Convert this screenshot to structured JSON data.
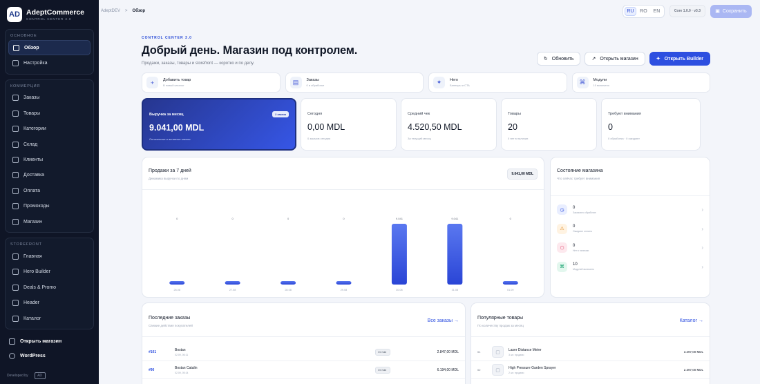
{
  "brand": {
    "name": "AdeptCommerce",
    "subtitle": "CONTROL CENTER 3.0",
    "logo_text": "AD"
  },
  "sidebar": {
    "sections": [
      {
        "title": "ОСНОВНОЕ",
        "items": [
          {
            "label": "Обзор",
            "icon": "grid-icon",
            "active": true
          },
          {
            "label": "Настройка",
            "icon": "sparkle-icon"
          }
        ]
      },
      {
        "title": "КОММЕРЦИЯ",
        "items": [
          {
            "label": "Заказы",
            "icon": "document-icon"
          },
          {
            "label": "Товары",
            "icon": "box-icon"
          },
          {
            "label": "Категории",
            "icon": "grid-icon"
          },
          {
            "label": "Склад",
            "icon": "warehouse-icon"
          },
          {
            "label": "Клиенты",
            "icon": "users-icon"
          },
          {
            "label": "Доставка",
            "icon": "truck-icon"
          },
          {
            "label": "Оплата",
            "icon": "card-icon"
          },
          {
            "label": "Промокоды",
            "icon": "tag-icon"
          },
          {
            "label": "Магазин",
            "icon": "store-icon"
          }
        ]
      },
      {
        "title": "STOREFRONT",
        "items": [
          {
            "label": "Главная",
            "icon": "home-icon"
          },
          {
            "label": "Hero Builder",
            "icon": "sparkle-icon"
          },
          {
            "label": "Deals & Promo",
            "icon": "sparkle-icon"
          },
          {
            "label": "Header",
            "icon": "layout-icon"
          },
          {
            "label": "Каталог",
            "icon": "grid-icon"
          }
        ]
      }
    ],
    "bottom": {
      "open_store": "Открыть магазин",
      "wordpress": "WordPress"
    },
    "developed_by": "Developed by",
    "dev_logo": "AD"
  },
  "topbar": {
    "crumb_root": "AdeptDEV",
    "crumb_sep": ">",
    "crumb_current": "Обзор",
    "langs": [
      "RU",
      "RO",
      "EN"
    ],
    "active_lang": "RU",
    "version": "Core 1.0.0 · v3.3",
    "save": "Сохранить"
  },
  "header": {
    "eyebrow": "CONTROL CENTER 3.0",
    "title": "Добрый день. Магазин под контролем.",
    "subtitle": "Продажи, заказы, товары и storefront — коротко и по делу.",
    "refresh": "Обновить",
    "open_store": "Открыть магазин",
    "open_builder": "Открыть Builder"
  },
  "quick": [
    {
      "title": "Добавить товар",
      "sub": "В новый каталог",
      "icon": "plus-icon"
    },
    {
      "title": "Заказы",
      "sub": "0 в обработке",
      "icon": "document-icon"
    },
    {
      "title": "Hero",
      "sub": "Баннеры и CTA",
      "icon": "sparkle-icon"
    },
    {
      "title": "Модули",
      "sub": "10 включено",
      "icon": "modules-icon"
    }
  ],
  "stats": [
    {
      "label": "Выручка за месяц",
      "value": "9.041,00 MDL",
      "note": "Оплаченные и активные заказы",
      "pill": "2 заказа"
    },
    {
      "label": "Сегодня",
      "value": "0,00 MDL",
      "note": "0 заказов сегодня"
    },
    {
      "label": "Средний чек",
      "value": "4.520,50 MDL",
      "note": "За текущий месяц"
    },
    {
      "label": "Товары",
      "value": "20",
      "note": "0 нет в наличии"
    },
    {
      "label": "Требуют внимания",
      "value": "0",
      "note": "0 обработка · 0 ожидают"
    }
  ],
  "sales": {
    "title": "Продажи за 7 дней",
    "subtitle": "Динамика выручки по дням",
    "total": "9.041,00 MDL"
  },
  "chart_data": {
    "type": "bar",
    "categories": [
      "26.08",
      "27.08",
      "28.08",
      "29.08",
      "30.08",
      "31.08",
      "01.09"
    ],
    "values": [
      0,
      0,
      0,
      0,
      9041,
      9041,
      0
    ],
    "value_labels": [
      "0",
      "0",
      "0",
      "0",
      "9.041",
      "9.041",
      "0"
    ],
    "title": "Продажи за 7 дней",
    "xlabel": "",
    "ylabel": "",
    "color": "#3050e0"
  },
  "health": {
    "title": "Состояние магазина",
    "subtitle": "Что сейчас требует внимания",
    "rows": [
      {
        "value": "0",
        "label": "Заказов в обработке",
        "icon": "clock-icon",
        "color": "#3050e0",
        "bg": "#e9eeff"
      },
      {
        "value": "0",
        "label": "Ожидают оплаты",
        "icon": "warning-icon",
        "color": "#e0861a",
        "bg": "#fff3e2"
      },
      {
        "value": "0",
        "label": "Нет в наличии",
        "icon": "box-icon",
        "color": "#e0436a",
        "bg": "#fde9ee"
      },
      {
        "value": "10",
        "label": "Модулей включено",
        "icon": "modules-icon",
        "color": "#13a06d",
        "bg": "#e3f7ee"
      }
    ]
  },
  "orders": {
    "title": "Последние заказы",
    "subtitle": "Свежие действия покупателей",
    "link": "Все заказы →",
    "rows": [
      {
        "id": "#101",
        "name": "Bostan",
        "date": "02.09, 06:11",
        "status": "On hold",
        "sum": "2.847,00 MDL"
      },
      {
        "id": "#90",
        "name": "Bostan Catalin",
        "date": "02.09, 05:14",
        "status": "On hold",
        "sum": "6.194,00 MDL"
      }
    ]
  },
  "products": {
    "title": "Популярные товары",
    "subtitle": "По количеству продаж за месяц",
    "link": "Каталог →",
    "rows": [
      {
        "rank": "01",
        "name": "Laser Distance Meter",
        "sold": "3 шт. продано",
        "sum": "3.297,00 MDL"
      },
      {
        "rank": "02",
        "name": "High Pressure Garden Sprayer",
        "sold": "2 шт. продано",
        "sum": "2.397,00 MDL"
      }
    ]
  }
}
